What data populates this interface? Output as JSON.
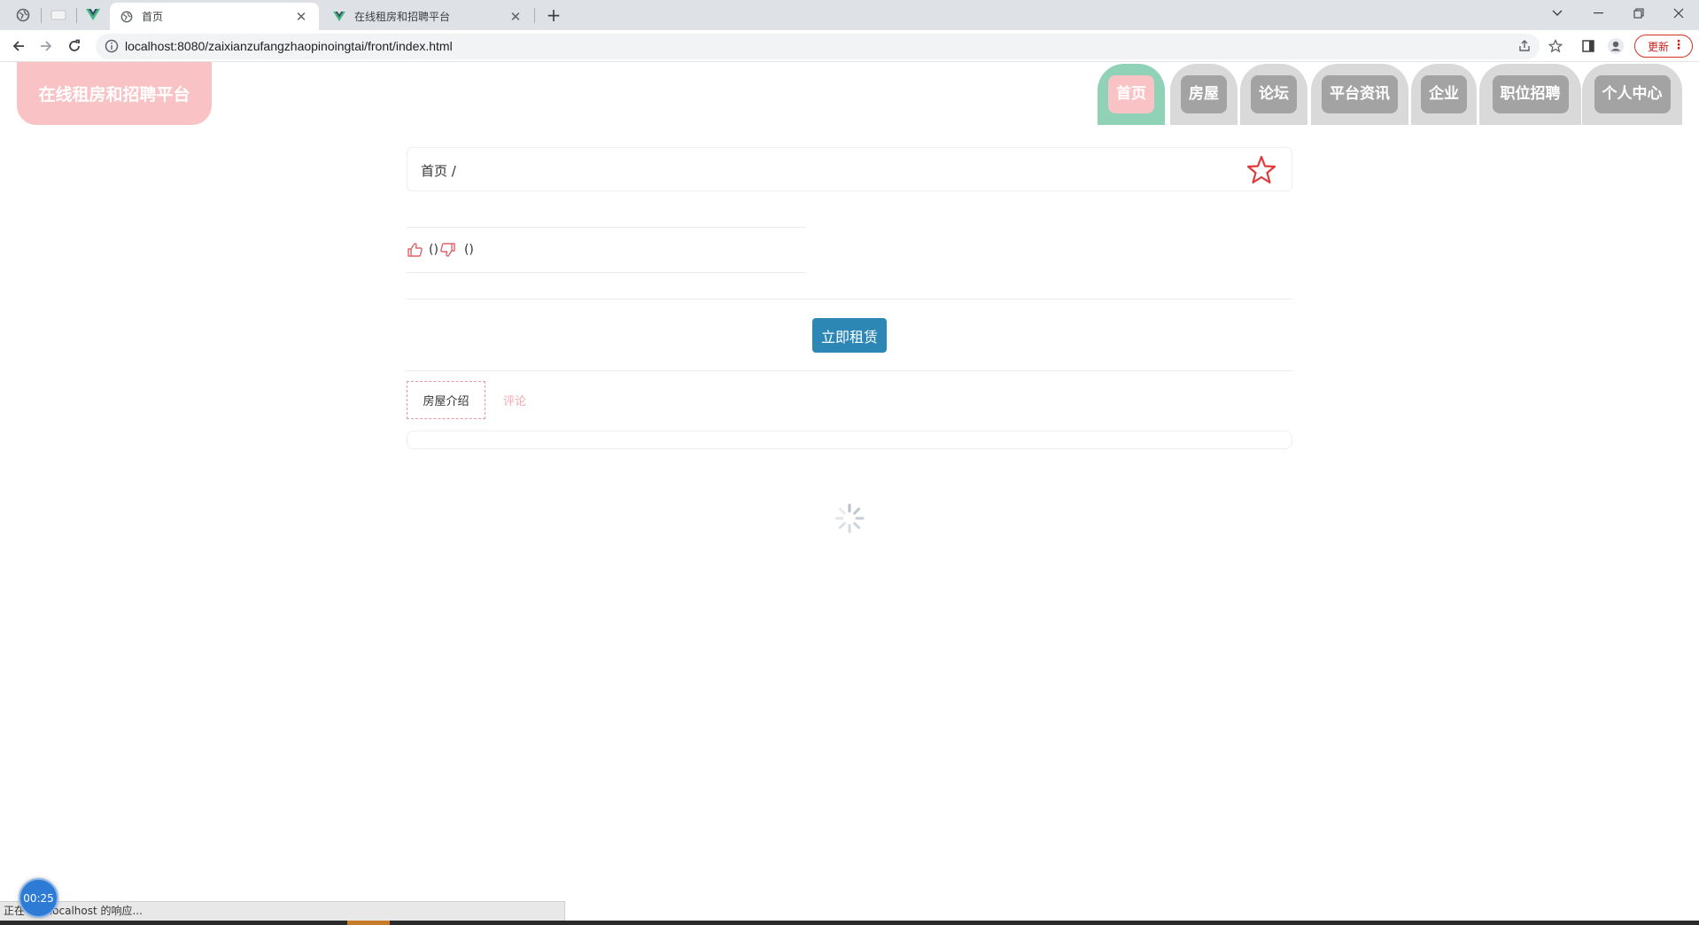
{
  "browser": {
    "tabs": [
      {
        "title": "首页",
        "active": true
      },
      {
        "title": "在线租房和招聘平台",
        "active": false
      }
    ],
    "url": "localhost:8080/zaixianzufangzhaopinoingtai/front/index.html",
    "update_label": "更新",
    "window_controls": [
      "chevron-down-icon",
      "minimize-icon",
      "restore-icon",
      "close-icon"
    ]
  },
  "site": {
    "logo": "在线租房和招聘平台",
    "nav": [
      {
        "label": "首页",
        "active": true
      },
      {
        "label": "房屋",
        "active": false
      },
      {
        "label": "论坛",
        "active": false
      },
      {
        "label": "平台资讯",
        "active": false
      },
      {
        "label": "企业",
        "active": false
      },
      {
        "label": "职位招聘",
        "active": false
      },
      {
        "label": "个人中心",
        "active": false
      }
    ],
    "colors": {
      "logo_bg": "#f9c2c4",
      "nav_active_outer": "#8fd2b8",
      "nav_inactive_outer": "#d9d9d9",
      "nav_label_bg": "#a3a3a3",
      "primary_button": "#2c87b5",
      "star": "#e03a3a"
    }
  },
  "page": {
    "breadcrumb": "首页 /",
    "likes": "()",
    "dislikes": "()",
    "rent_button": "立即租赁",
    "detail_tabs": {
      "intro": "房屋介绍",
      "comment": "评论"
    }
  },
  "status": {
    "text": "正在等待 localhost 的响应...",
    "timer": "00:25"
  }
}
